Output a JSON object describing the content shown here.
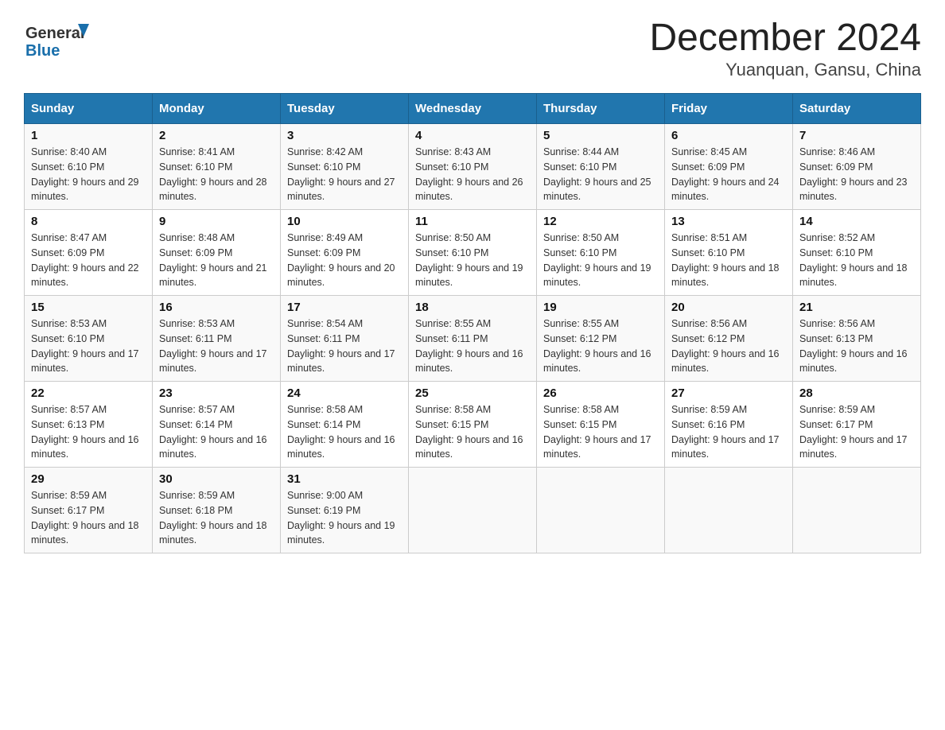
{
  "header": {
    "logo_general": "General",
    "logo_blue": "Blue",
    "month_year": "December 2024",
    "location": "Yuanquan, Gansu, China"
  },
  "weekdays": [
    "Sunday",
    "Monday",
    "Tuesday",
    "Wednesday",
    "Thursday",
    "Friday",
    "Saturday"
  ],
  "weeks": [
    [
      {
        "day": "1",
        "sunrise": "8:40 AM",
        "sunset": "6:10 PM",
        "daylight": "9 hours and 29 minutes."
      },
      {
        "day": "2",
        "sunrise": "8:41 AM",
        "sunset": "6:10 PM",
        "daylight": "9 hours and 28 minutes."
      },
      {
        "day": "3",
        "sunrise": "8:42 AM",
        "sunset": "6:10 PM",
        "daylight": "9 hours and 27 minutes."
      },
      {
        "day": "4",
        "sunrise": "8:43 AM",
        "sunset": "6:10 PM",
        "daylight": "9 hours and 26 minutes."
      },
      {
        "day": "5",
        "sunrise": "8:44 AM",
        "sunset": "6:10 PM",
        "daylight": "9 hours and 25 minutes."
      },
      {
        "day": "6",
        "sunrise": "8:45 AM",
        "sunset": "6:09 PM",
        "daylight": "9 hours and 24 minutes."
      },
      {
        "day": "7",
        "sunrise": "8:46 AM",
        "sunset": "6:09 PM",
        "daylight": "9 hours and 23 minutes."
      }
    ],
    [
      {
        "day": "8",
        "sunrise": "8:47 AM",
        "sunset": "6:09 PM",
        "daylight": "9 hours and 22 minutes."
      },
      {
        "day": "9",
        "sunrise": "8:48 AM",
        "sunset": "6:09 PM",
        "daylight": "9 hours and 21 minutes."
      },
      {
        "day": "10",
        "sunrise": "8:49 AM",
        "sunset": "6:09 PM",
        "daylight": "9 hours and 20 minutes."
      },
      {
        "day": "11",
        "sunrise": "8:50 AM",
        "sunset": "6:10 PM",
        "daylight": "9 hours and 19 minutes."
      },
      {
        "day": "12",
        "sunrise": "8:50 AM",
        "sunset": "6:10 PM",
        "daylight": "9 hours and 19 minutes."
      },
      {
        "day": "13",
        "sunrise": "8:51 AM",
        "sunset": "6:10 PM",
        "daylight": "9 hours and 18 minutes."
      },
      {
        "day": "14",
        "sunrise": "8:52 AM",
        "sunset": "6:10 PM",
        "daylight": "9 hours and 18 minutes."
      }
    ],
    [
      {
        "day": "15",
        "sunrise": "8:53 AM",
        "sunset": "6:10 PM",
        "daylight": "9 hours and 17 minutes."
      },
      {
        "day": "16",
        "sunrise": "8:53 AM",
        "sunset": "6:11 PM",
        "daylight": "9 hours and 17 minutes."
      },
      {
        "day": "17",
        "sunrise": "8:54 AM",
        "sunset": "6:11 PM",
        "daylight": "9 hours and 17 minutes."
      },
      {
        "day": "18",
        "sunrise": "8:55 AM",
        "sunset": "6:11 PM",
        "daylight": "9 hours and 16 minutes."
      },
      {
        "day": "19",
        "sunrise": "8:55 AM",
        "sunset": "6:12 PM",
        "daylight": "9 hours and 16 minutes."
      },
      {
        "day": "20",
        "sunrise": "8:56 AM",
        "sunset": "6:12 PM",
        "daylight": "9 hours and 16 minutes."
      },
      {
        "day": "21",
        "sunrise": "8:56 AM",
        "sunset": "6:13 PM",
        "daylight": "9 hours and 16 minutes."
      }
    ],
    [
      {
        "day": "22",
        "sunrise": "8:57 AM",
        "sunset": "6:13 PM",
        "daylight": "9 hours and 16 minutes."
      },
      {
        "day": "23",
        "sunrise": "8:57 AM",
        "sunset": "6:14 PM",
        "daylight": "9 hours and 16 minutes."
      },
      {
        "day": "24",
        "sunrise": "8:58 AM",
        "sunset": "6:14 PM",
        "daylight": "9 hours and 16 minutes."
      },
      {
        "day": "25",
        "sunrise": "8:58 AM",
        "sunset": "6:15 PM",
        "daylight": "9 hours and 16 minutes."
      },
      {
        "day": "26",
        "sunrise": "8:58 AM",
        "sunset": "6:15 PM",
        "daylight": "9 hours and 17 minutes."
      },
      {
        "day": "27",
        "sunrise": "8:59 AM",
        "sunset": "6:16 PM",
        "daylight": "9 hours and 17 minutes."
      },
      {
        "day": "28",
        "sunrise": "8:59 AM",
        "sunset": "6:17 PM",
        "daylight": "9 hours and 17 minutes."
      }
    ],
    [
      {
        "day": "29",
        "sunrise": "8:59 AM",
        "sunset": "6:17 PM",
        "daylight": "9 hours and 18 minutes."
      },
      {
        "day": "30",
        "sunrise": "8:59 AM",
        "sunset": "6:18 PM",
        "daylight": "9 hours and 18 minutes."
      },
      {
        "day": "31",
        "sunrise": "9:00 AM",
        "sunset": "6:19 PM",
        "daylight": "9 hours and 19 minutes."
      },
      null,
      null,
      null,
      null
    ]
  ]
}
